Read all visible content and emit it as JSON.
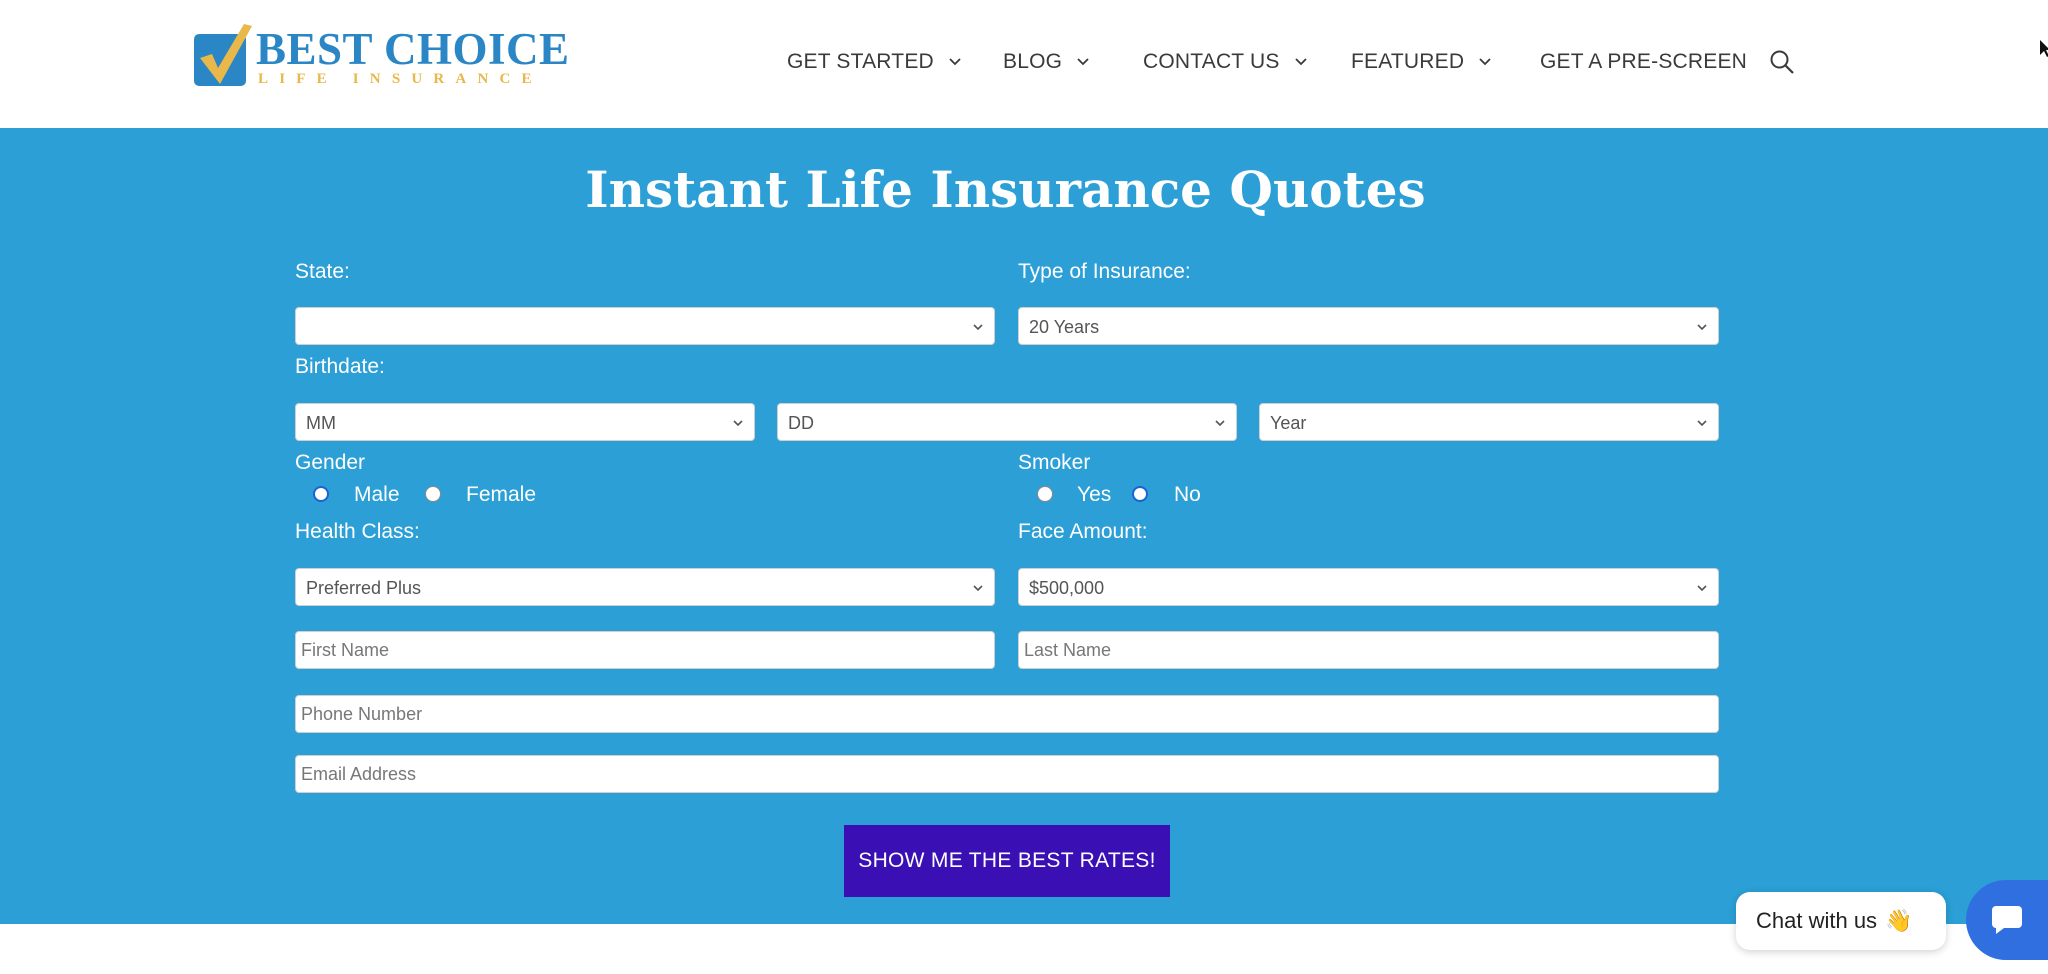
{
  "brand": {
    "name": "BEST CHOICE",
    "tagline": "LIFE INSURANCE"
  },
  "nav": {
    "items": [
      {
        "label": "GET STARTED",
        "has_dropdown": true
      },
      {
        "label": "BLOG",
        "has_dropdown": true
      },
      {
        "label": "CONTACT US",
        "has_dropdown": true
      },
      {
        "label": "FEATURED",
        "has_dropdown": true
      },
      {
        "label": "GET A PRE-SCREEN",
        "has_dropdown": false
      }
    ],
    "search_icon": "search-icon"
  },
  "form": {
    "title": "Instant Life Insurance Quotes",
    "state": {
      "label": "State:",
      "value": ""
    },
    "insurance_type": {
      "label": "Type of Insurance:",
      "value": "20 Years"
    },
    "birthdate": {
      "label": "Birthdate:",
      "month": "MM",
      "day": "DD",
      "year": "Year"
    },
    "gender": {
      "label": "Gender",
      "options": [
        "Male",
        "Female"
      ],
      "selected": "Male"
    },
    "smoker": {
      "label": "Smoker",
      "options": [
        "Yes",
        "No"
      ],
      "selected": "No"
    },
    "health_class": {
      "label": "Health Class:",
      "value": "Preferred Plus"
    },
    "face_amount": {
      "label": "Face Amount:",
      "value": "$500,000"
    },
    "first_name": {
      "placeholder": "First Name",
      "value": ""
    },
    "last_name": {
      "placeholder": "Last Name",
      "value": ""
    },
    "phone": {
      "placeholder": "Phone Number",
      "value": ""
    },
    "email": {
      "placeholder": "Email Address",
      "value": ""
    },
    "submit_label": "SHOW ME THE BEST RATES!"
  },
  "chat": {
    "label": "Chat with us",
    "emoji": "👋",
    "icon": "chat-bubble-icon"
  },
  "colors": {
    "band": "#2b9fd6",
    "brand_blue": "#2a86c4",
    "brand_gold": "#e8b84a",
    "submit": "#3a10b4",
    "chat": "#2f6fe0"
  }
}
